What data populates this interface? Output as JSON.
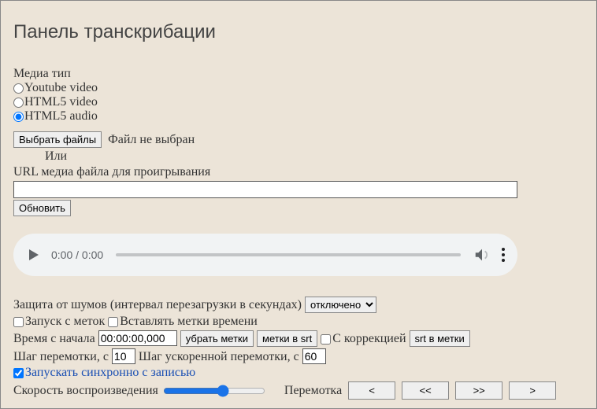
{
  "title": "Панель транскрибации",
  "mediaType": {
    "label": "Медиа тип",
    "options": {
      "youtube": "Youtube video",
      "html5video": "HTML5 video",
      "html5audio": "HTML5 audio"
    }
  },
  "file": {
    "button": "Выбрать файлы",
    "status": "Файл не выбран",
    "or": "Или",
    "urlLabel": "URL медиа файла для проигрывания",
    "update": "Обновить"
  },
  "player": {
    "time": "0:00 / 0:00"
  },
  "noise": {
    "label": "Защита от шумов (интервал перезагрузки в секундах)",
    "selected": "отключено"
  },
  "checkboxes": {
    "startFromMarks": "Запуск с меток",
    "insertTimestamps": "Вставлять метки времени",
    "withCorrection": "С коррекцией",
    "syncWithRecord": "Запускать синхронно с записью"
  },
  "timeRow": {
    "label": "Время с начала",
    "value": "00:00:00,000",
    "removeMarks": "убрать метки",
    "marksToSrt": "метки в srt",
    "srtToMarks": "srt в метки"
  },
  "steps": {
    "stepLabel": "Шаг перемотки, с",
    "stepValue": "10",
    "fastLabel": "Шаг ускоренной перемотки, с",
    "fastValue": "60"
  },
  "speed": {
    "label": "Скорость воспроизведения"
  },
  "rewind": {
    "label": "Перемотка",
    "btn1": "<",
    "btn2": "<<",
    "btn3": ">>",
    "btn4": ">"
  }
}
